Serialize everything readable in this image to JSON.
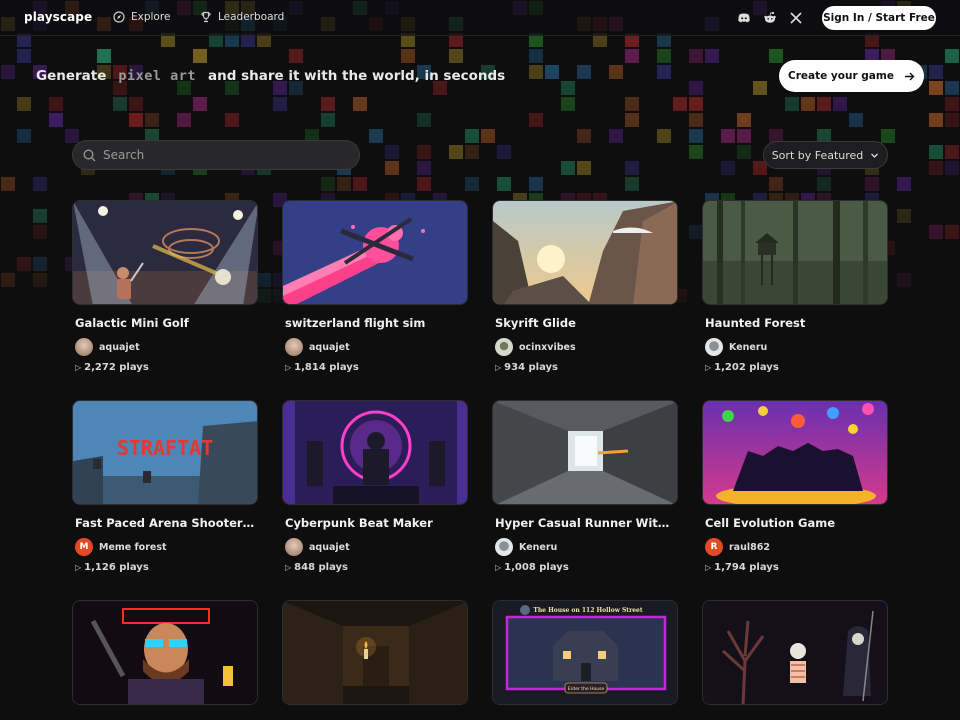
{
  "nav": {
    "logo": "playscape",
    "explore": "Explore",
    "leaderboard": "Leaderboard",
    "signin": "Sign In / Start Free",
    "social_icons": [
      "discord-icon",
      "reddit-icon",
      "x-icon"
    ]
  },
  "hero": {
    "prefix": "Generate",
    "highlight": "pixel art",
    "suffix": "and share it with the world, in seconds",
    "create_button": "Create your game"
  },
  "search": {
    "placeholder": "Search",
    "value": ""
  },
  "sort": {
    "label": "Sort by Featured"
  },
  "colors": {
    "background": "#0e0e0f",
    "card_border": "#2e2e30",
    "button_bg": "#ffffff"
  },
  "games": [
    {
      "title": "Galactic Mini Golf",
      "author": "aquajet",
      "plays": "2,272 plays"
    },
    {
      "title": "switzerland flight sim",
      "author": "aquajet",
      "plays": "1,814 plays"
    },
    {
      "title": "Skyrift Glide",
      "author": "ocinxvibes",
      "plays": "934 plays"
    },
    {
      "title": "Haunted Forest",
      "author": "Keneru",
      "plays": "1,202 plays"
    },
    {
      "title": "Fast Paced Arena Shooter Sk...",
      "author": "Meme forest",
      "avatar_letter": "M",
      "plays": "1,126 plays"
    },
    {
      "title": "Cyberpunk Beat Maker",
      "author": "aquajet",
      "plays": "848 plays"
    },
    {
      "title": "Hyper Casual Runner With G...",
      "author": "Keneru",
      "plays": "1,008 plays"
    },
    {
      "title": "Cell Evolution Game",
      "author": "raul862",
      "avatar_letter": "R",
      "plays": "1,794 plays"
    },
    {
      "thumb_text": "",
      "title": "",
      "author": "",
      "plays": ""
    },
    {
      "title": "",
      "author": "",
      "plays": ""
    },
    {
      "thumb_text": "The House on 112 Hollow Street",
      "thumb_button": "Enter the House",
      "title": "",
      "author": "",
      "plays": ""
    },
    {
      "title": "",
      "author": "",
      "plays": ""
    }
  ],
  "thumb_texts": {
    "straftat": "STRAFTAT"
  }
}
